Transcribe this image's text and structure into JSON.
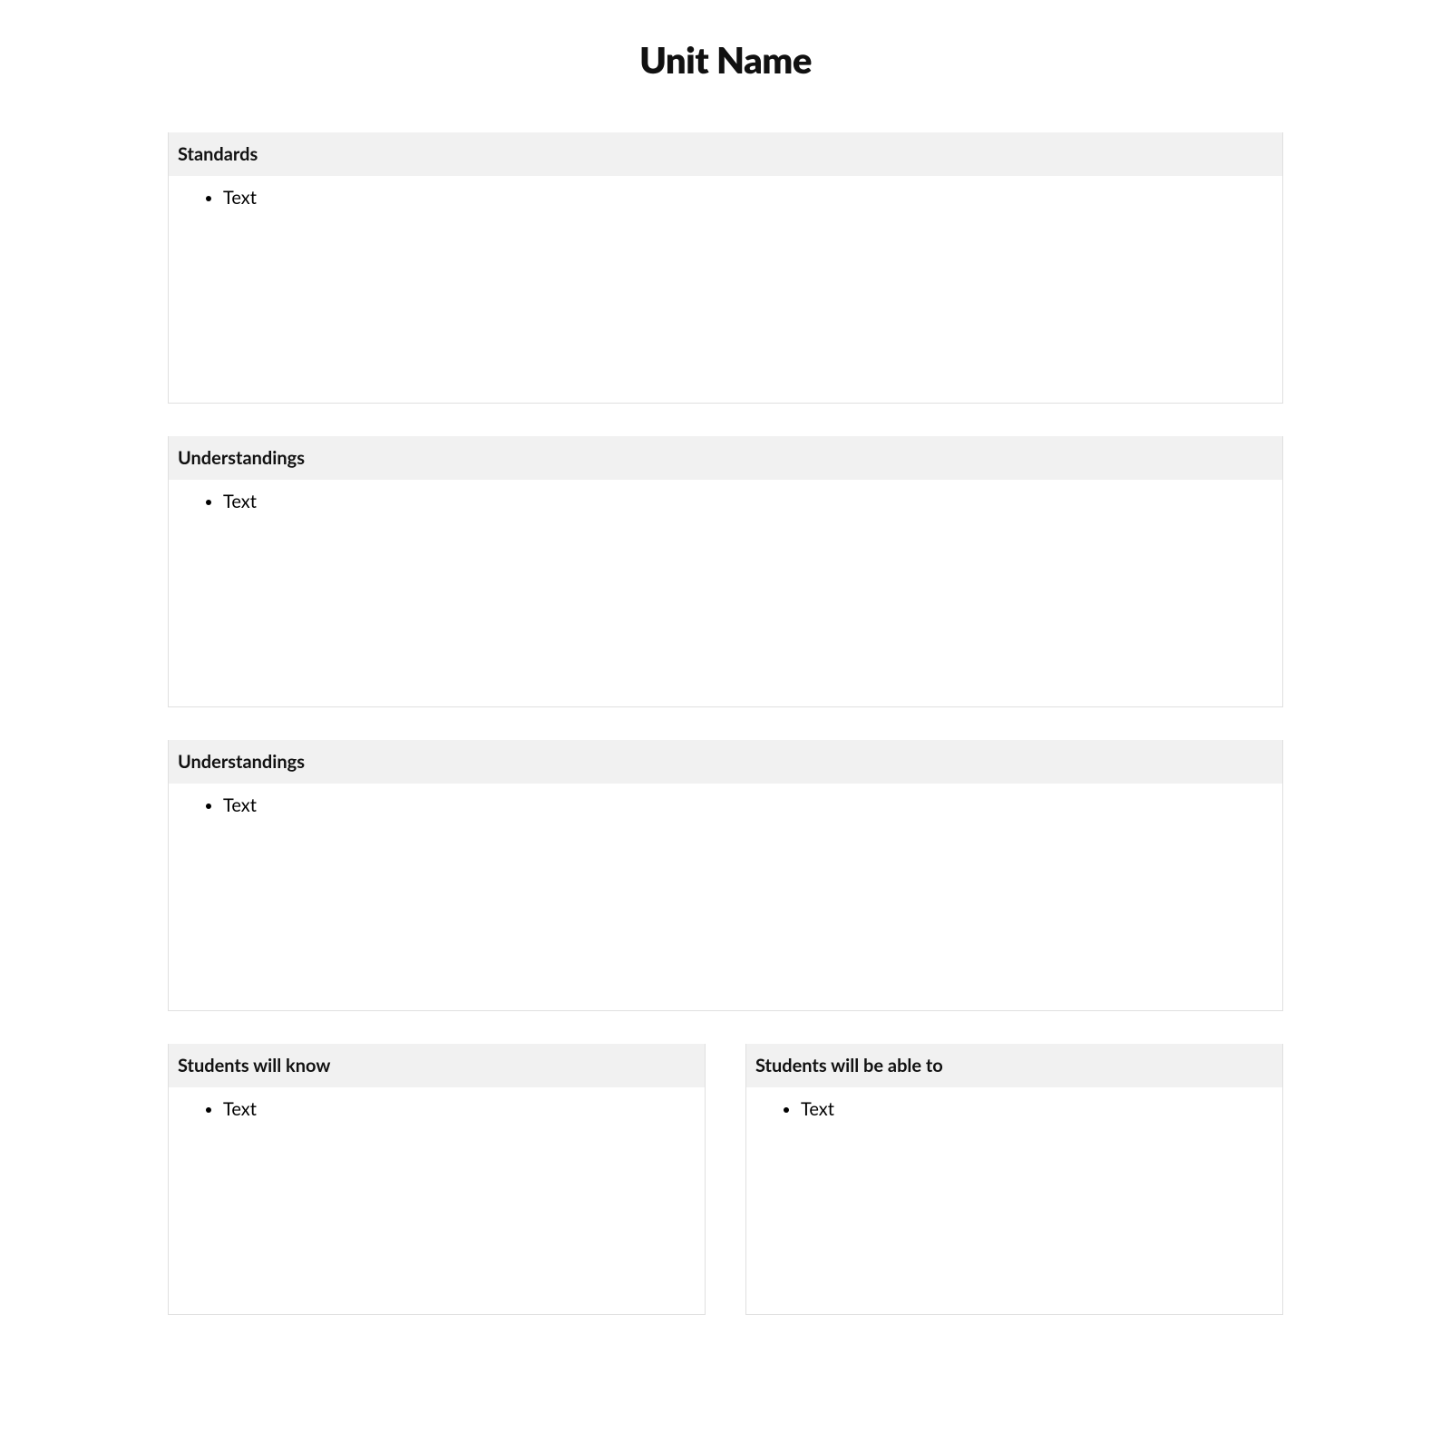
{
  "title": "Unit Name",
  "sections": [
    {
      "header": "Standards",
      "items": [
        "Text"
      ]
    },
    {
      "header": "Understandings",
      "items": [
        "Text"
      ]
    },
    {
      "header": "Understandings",
      "items": [
        "Text"
      ]
    }
  ],
  "two_col": {
    "left": {
      "header": "Students will know",
      "items": [
        "Text"
      ]
    },
    "right": {
      "header": "Students will be able to",
      "items": [
        "Text"
      ]
    }
  }
}
